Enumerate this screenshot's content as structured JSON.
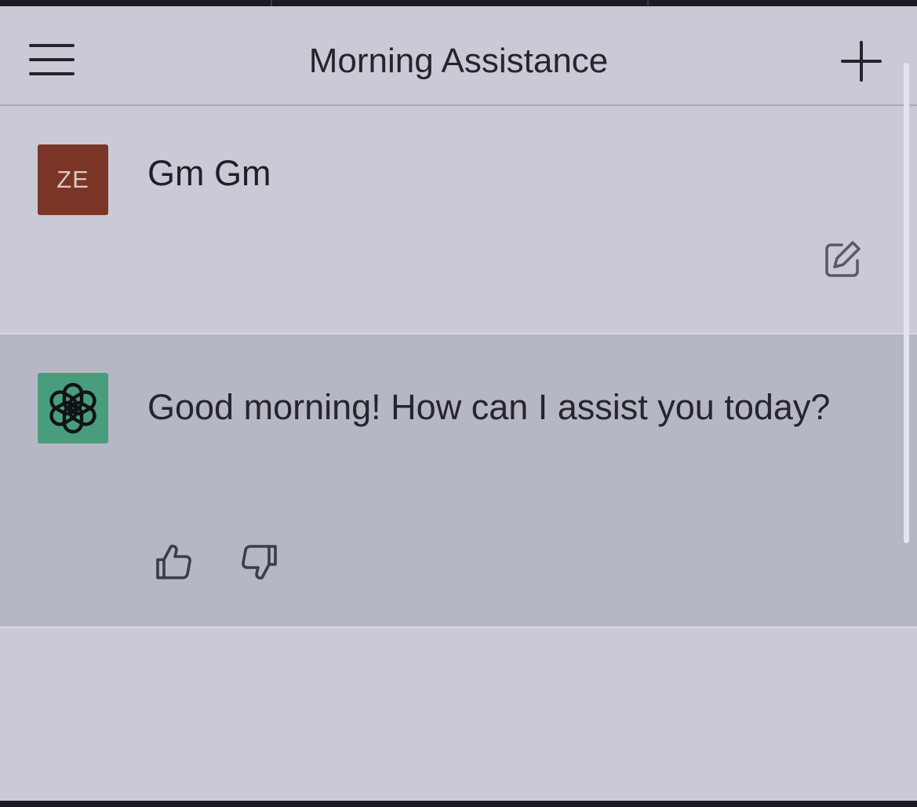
{
  "header": {
    "title": "Morning Assistance",
    "menu_icon": "hamburger-menu-icon",
    "new_chat_icon": "plus-icon"
  },
  "conversation": {
    "user_message": {
      "avatar_initials": "ZE",
      "avatar_color": "#7b3527",
      "text": "Gm Gm",
      "edit_icon": "edit-icon"
    },
    "assistant_message": {
      "avatar_icon": "openai-logo-icon",
      "avatar_color": "#4a9d7c",
      "text": "Good morning! How can I assist you today?",
      "feedback_icons": [
        "thumbs-up-icon",
        "thumbs-down-icon"
      ]
    }
  },
  "colors": {
    "background": "#cacad6",
    "assistant_row_background": "#b6b7c4",
    "text": "#25262d"
  }
}
